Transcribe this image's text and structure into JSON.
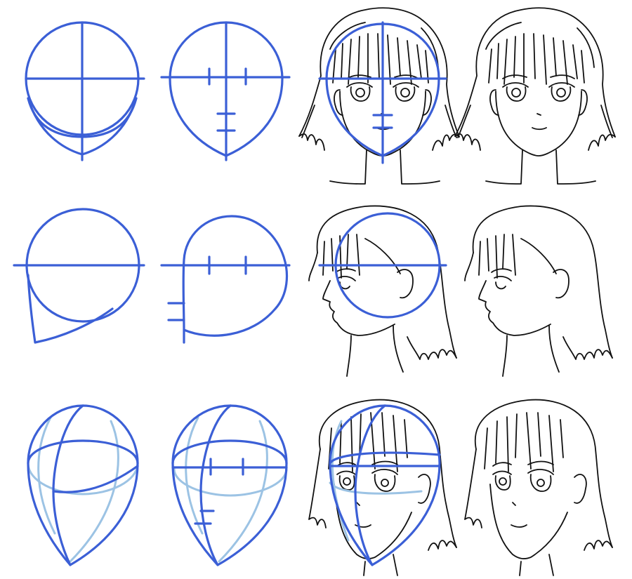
{
  "colors": {
    "background": "#ffffff",
    "guide_blue": "#3b5fd6",
    "guide_light_blue": "#9cc3e4",
    "ink": "#111111"
  },
  "rows": [
    {
      "view": "front",
      "steps": [
        "guide-circle",
        "guide-head-shape",
        "sketch-over-guides",
        "final-ink"
      ]
    },
    {
      "view": "side-profile",
      "steps": [
        "guide-circle",
        "guide-head-shape",
        "sketch-over-guides",
        "final-ink"
      ]
    },
    {
      "view": "three-quarter",
      "steps": [
        "guide-sphere",
        "guide-head-shape",
        "sketch-over-guides",
        "final-ink"
      ]
    }
  ]
}
